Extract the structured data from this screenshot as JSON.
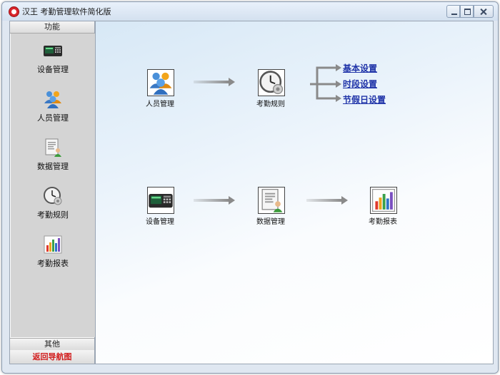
{
  "window": {
    "title": "汉王 考勤管理软件简化版"
  },
  "sidebar": {
    "header": "功能",
    "items": [
      {
        "label": "设备管理",
        "icon": "device-terminal-icon"
      },
      {
        "label": "人员管理",
        "icon": "users-icon"
      },
      {
        "label": "数据管理",
        "icon": "data-document-icon"
      },
      {
        "label": "考勤规则",
        "icon": "clock-icon"
      },
      {
        "label": "考勤报表",
        "icon": "bar-chart-icon"
      }
    ],
    "other": "其他",
    "back": "返回导航图"
  },
  "flow": {
    "personnel": "人员管理",
    "rules": "考勤规则",
    "device": "设备管理",
    "data": "数据管理",
    "report": "考勤报表"
  },
  "links": {
    "basic": "基本设置",
    "period": "时段设置",
    "holiday": "节假日设置"
  },
  "colors": {
    "link": "#1f33a8",
    "back_text": "#d21b1b"
  }
}
